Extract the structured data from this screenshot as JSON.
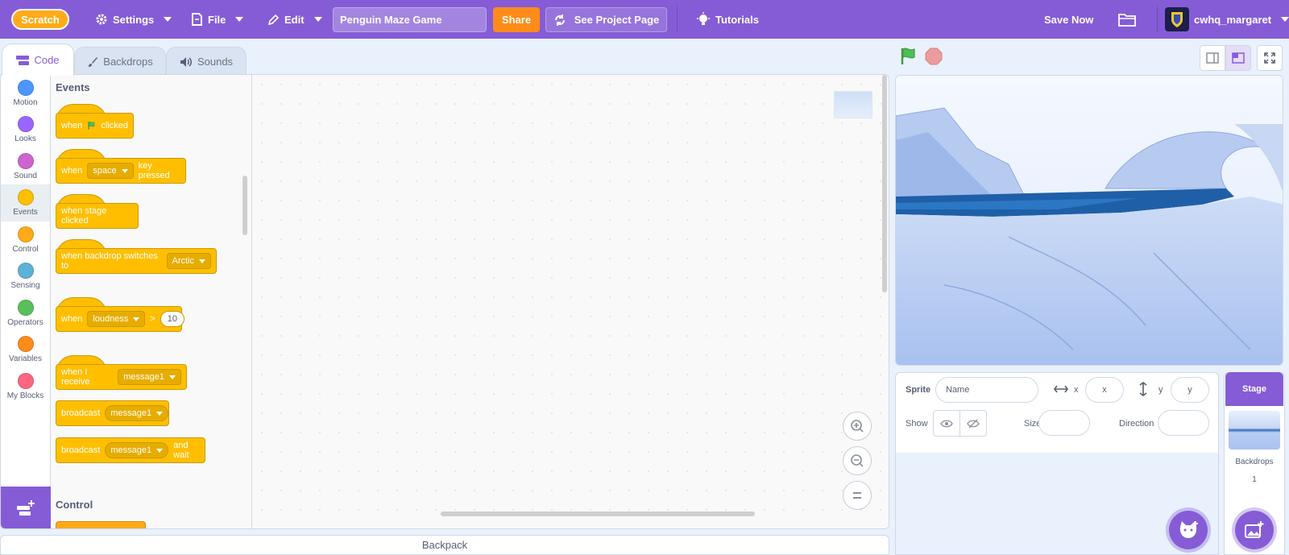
{
  "menubar": {
    "logo": "Scratch",
    "settings_label": "Settings",
    "file_label": "File",
    "edit_label": "Edit",
    "project_title": "Penguin Maze Game",
    "share_label": "Share",
    "see_project_label": "See Project Page",
    "tutorials_label": "Tutorials",
    "save_now_label": "Save Now",
    "username": "cwhq_margaret"
  },
  "tabs": [
    {
      "label": "Code",
      "active": true
    },
    {
      "label": "Backdrops",
      "active": false
    },
    {
      "label": "Sounds",
      "active": false
    }
  ],
  "categories": [
    {
      "label": "Motion",
      "color": "#4c97ff"
    },
    {
      "label": "Looks",
      "color": "#9966ff"
    },
    {
      "label": "Sound",
      "color": "#cf63cf"
    },
    {
      "label": "Events",
      "color": "#ffbf00",
      "selected": true
    },
    {
      "label": "Control",
      "color": "#ffab19"
    },
    {
      "label": "Sensing",
      "color": "#5cb1d6"
    },
    {
      "label": "Operators",
      "color": "#59c059"
    },
    {
      "label": "Variables",
      "color": "#ff8c1a"
    },
    {
      "label": "My Blocks",
      "color": "#ff6680"
    }
  ],
  "flyout": {
    "events_title": "Events",
    "control_title": "Control",
    "blocks": {
      "flag_when": "when",
      "flag_clicked": "clicked",
      "key_when": "when",
      "key_value": "space",
      "key_pressed": "key pressed",
      "stage_clicked": "when stage clicked",
      "backdrop_switch": "when backdrop switches to",
      "backdrop_value": "Arctic",
      "loud_when": "when",
      "loud_value": "loudness",
      "loud_op": ">",
      "loud_num": "10",
      "receive_label": "when I receive",
      "receive_value": "message1",
      "broadcast_label": "broadcast",
      "broadcast_value": "message1",
      "broadcastwait_label": "broadcast",
      "broadcastwait_value": "message1",
      "broadcastwait_suffix": "and wait"
    }
  },
  "backpack_label": "Backpack",
  "sprite_info": {
    "sprite_label": "Sprite",
    "name_placeholder": "Name",
    "x_label": "x",
    "x_placeholder": "x",
    "y_label": "y",
    "y_placeholder": "y",
    "show_label": "Show",
    "size_label": "Size",
    "direction_label": "Direction"
  },
  "stage_pane": {
    "title": "Stage",
    "backdrops_label": "Backdrops",
    "backdrops_count": "1"
  },
  "colors": {
    "brand": "#855cd6",
    "share": "#ff8c1a",
    "events": "#ffbf00",
    "green_flag": "#4cbf56",
    "stop": "#ec9c9c"
  }
}
